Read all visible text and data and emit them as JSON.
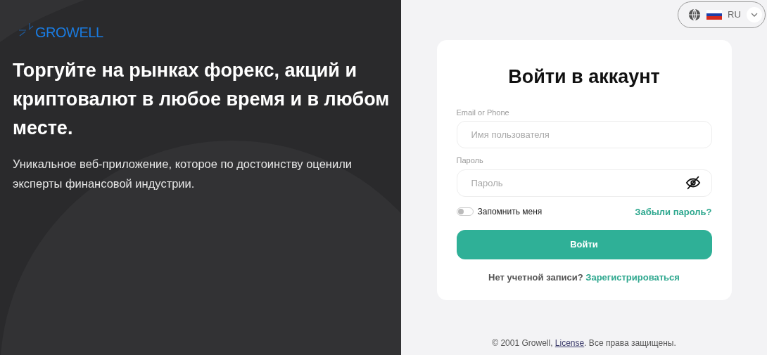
{
  "logo": {
    "text": "GROWELL"
  },
  "hero": {
    "headline": "Торгуйте на рынках форекс, акций и криптовалют в любое время и в любом месте.",
    "subtitle": "Уникальное веб-приложение, которое по достоинству оценили эксперты финансовой индустрии."
  },
  "language": {
    "code": "RU"
  },
  "login": {
    "title": "Войти в аккаунт",
    "fields": [
      {
        "label": "Email or Phone",
        "placeholder": "Имя пользователя",
        "kind": "text"
      },
      {
        "label": "Пароль",
        "placeholder": "Пароль",
        "kind": "password"
      }
    ],
    "remember": {
      "label": "Запомнить меня",
      "on": false
    },
    "forgot": "Забыли пароль?",
    "submit": "Войти",
    "signup": {
      "text": "Нет учетной записи?",
      "link": "Зарегистрироваться"
    }
  },
  "footer": {
    "prefix": "© 2001 Growell, ",
    "link": "License",
    "suffix": ". Все права защищены."
  }
}
